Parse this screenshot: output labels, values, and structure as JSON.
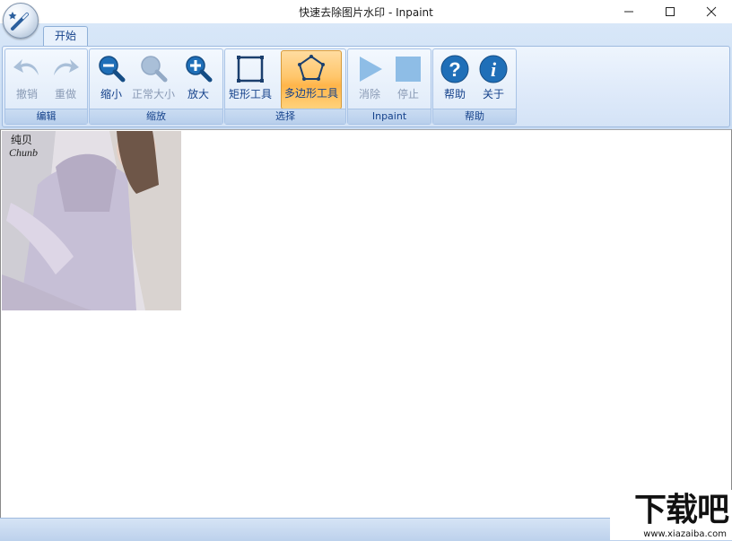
{
  "window": {
    "title": "快速去除图片水印 - Inpaint",
    "controls": {
      "minimize": "—",
      "maximize": "☐",
      "close": "✕"
    }
  },
  "ribbon": {
    "tab": "开始",
    "groups": {
      "edit": {
        "label": "编辑",
        "undo": "撤销",
        "redo": "重做"
      },
      "zoom": {
        "label": "缩放",
        "zoom_out": "缩小",
        "normal": "正常大小",
        "zoom_in": "放大"
      },
      "select": {
        "label": "选择",
        "rect": "矩形工具",
        "polygon": "多边形工具"
      },
      "inpaint": {
        "label": "Inpaint",
        "erase": "消除",
        "stop": "停止"
      },
      "help": {
        "label": "帮助",
        "help": "帮助",
        "about": "关于"
      }
    }
  },
  "image": {
    "watermark_line1": "纯贝",
    "watermark_line2": "Chunb"
  },
  "site_watermark": {
    "brand": "下载吧",
    "url": "www.xiazaiba.com"
  },
  "colors": {
    "accent": "#15428b",
    "icon_blue": "#1f6fb8",
    "active": "#ffc66b"
  }
}
